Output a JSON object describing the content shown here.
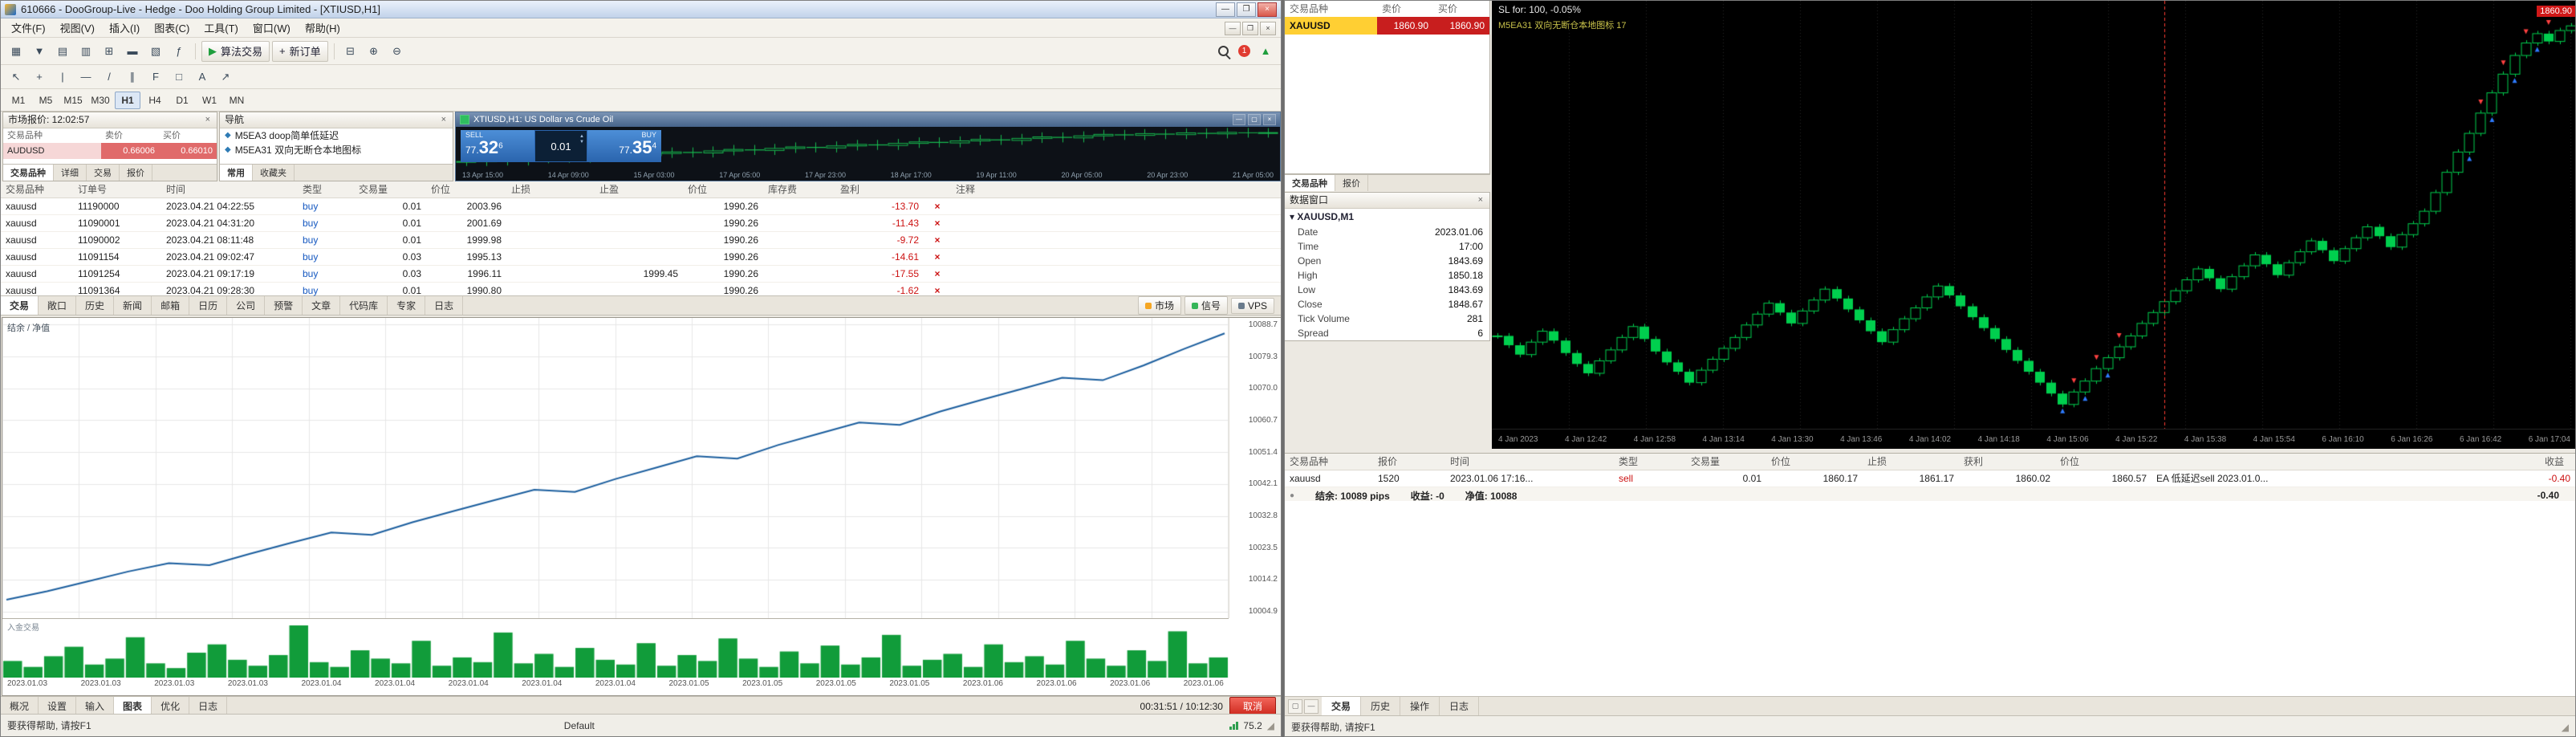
{
  "icons": {
    "close": "×",
    "min": "—",
    "restore": "❐",
    "maximize": "▢",
    "up": "▲",
    "down": "▼",
    "play": "▶",
    "plus": "+",
    "robot": "◆",
    "dot": "●",
    "grip": "◢",
    "dropdown": "▾"
  },
  "left": {
    "title": "610666 - DooGroup-Live - Hedge - Doo Holding Group Limited - [XTIUSD,H1]",
    "menus": [
      "文件(F)",
      "视图(V)",
      "插入(I)",
      "图表(C)",
      "工具(T)",
      "窗口(W)",
      "帮助(H)"
    ],
    "toolbar1": [
      {
        "name": "new-chart-icon",
        "glyph": "▦"
      },
      {
        "name": "profiles-icon",
        "glyph": "▼"
      },
      {
        "name": "market-watch-icon",
        "glyph": "▤"
      },
      {
        "name": "data-window-icon",
        "glyph": "▥"
      },
      {
        "name": "navigator-icon",
        "glyph": "⊞"
      },
      {
        "name": "toolbox-icon",
        "glyph": "▬"
      },
      {
        "name": "strategy-tester-icon",
        "glyph": "▧"
      },
      {
        "name": "indicators-icon",
        "glyph": "ƒ"
      }
    ],
    "algo_button": "算法交易",
    "new_order_button": "新订单",
    "toolbar1_right": [
      {
        "name": "tile-windows-icon",
        "glyph": "⊟"
      },
      {
        "name": "zoom-in-icon",
        "glyph": "⊕"
      },
      {
        "name": "zoom-out-icon",
        "glyph": "⊖"
      }
    ],
    "badge": "1",
    "toolbar2": [
      {
        "name": "cursor-icon",
        "glyph": "↖"
      },
      {
        "name": "crosshair-icon",
        "glyph": "+"
      },
      {
        "name": "vertical-line-icon",
        "glyph": "|"
      },
      {
        "name": "horizontal-line-icon",
        "glyph": "—"
      },
      {
        "name": "trendline-icon",
        "glyph": "/"
      },
      {
        "name": "channel-icon",
        "glyph": "∥"
      },
      {
        "name": "fibonacci-icon",
        "glyph": "F"
      },
      {
        "name": "shapes-icon",
        "glyph": "□"
      },
      {
        "name": "text-icon",
        "glyph": "A"
      },
      {
        "name": "arrows-icon",
        "glyph": "↗"
      }
    ],
    "timeframes": [
      {
        "label": "M1"
      },
      {
        "label": "M5"
      },
      {
        "label": "M15"
      },
      {
        "label": "M30"
      },
      {
        "label": "H1",
        "active": true
      },
      {
        "label": "H4"
      },
      {
        "label": "D1"
      },
      {
        "label": "W1"
      },
      {
        "label": "MN"
      }
    ],
    "market_watch": {
      "title": "市场报价: 12:02:57",
      "columns": [
        "交易品种",
        "卖价",
        "买价"
      ],
      "symbol": "AUDUSD",
      "bid": "0.66006",
      "ask": "0.66010",
      "tabs": [
        {
          "label": "交易品种",
          "active": true
        },
        {
          "label": "详细"
        },
        {
          "label": "交易"
        },
        {
          "label": "报价"
        }
      ]
    },
    "navigator": {
      "title": "导航",
      "items": [
        "M5EA3 doop简单低延迟",
        "M5EA31 双向无断仓本地图标"
      ],
      "tabs": [
        {
          "label": "常用",
          "active": true
        },
        {
          "label": "收藏夹"
        }
      ]
    },
    "popup": {
      "title": "XTIUSD,H1: US Dollar vs Crude Oil",
      "sell_label": "SELL",
      "sell_prefix": "77.",
      "sell_big": "32",
      "sell_sup": "6",
      "volume": "0.01",
      "buy_label": "BUY",
      "buy_prefix": "77.",
      "buy_big": "35",
      "buy_sup": "4"
    },
    "orders": {
      "columns": [
        "交易品种",
        "订单号",
        "时间",
        "类型",
        "交易量",
        "价位",
        "止损",
        "止盈",
        "价位",
        "库存费",
        "盈利",
        "注释"
      ],
      "rows": [
        {
          "symbol": "xauusd",
          "order": "11190000",
          "time": "2023.04.21 04:22:55",
          "type": "buy",
          "volume": "0.01",
          "price": "2003.96",
          "sl": "",
          "tp": "",
          "price2": "1990.26",
          "swap": "",
          "profit": "-13.70"
        },
        {
          "symbol": "xauusd",
          "order": "11090001",
          "time": "2023.04.21 04:31:20",
          "type": "buy",
          "volume": "0.01",
          "price": "2001.69",
          "sl": "",
          "tp": "",
          "price2": "1990.26",
          "swap": "",
          "profit": "-11.43"
        },
        {
          "symbol": "xauusd",
          "order": "11090002",
          "time": "2023.04.21 08:11:48",
          "type": "buy",
          "volume": "0.01",
          "price": "1999.98",
          "sl": "",
          "tp": "",
          "price2": "1990.26",
          "swap": "",
          "profit": "-9.72"
        },
        {
          "symbol": "xauusd",
          "order": "11091154",
          "time": "2023.04.21 09:02:47",
          "type": "buy",
          "volume": "0.03",
          "price": "1995.13",
          "sl": "",
          "tp": "",
          "price2": "1990.26",
          "swap": "",
          "profit": "-14.61"
        },
        {
          "symbol": "xauusd",
          "order": "11091254",
          "time": "2023.04.21 09:17:19",
          "type": "buy",
          "volume": "0.03",
          "price": "1996.11",
          "sl": "",
          "tp": "1999.45",
          "price2": "1990.26",
          "swap": "",
          "profit": "-17.55"
        },
        {
          "symbol": "xauusd",
          "order": "11091364",
          "time": "2023.04.21 09:28:30",
          "type": "buy",
          "volume": "0.01",
          "price": "1990.80",
          "sl": "",
          "tp": "",
          "price2": "1990.26",
          "swap": "",
          "profit": "-1.62"
        }
      ]
    },
    "toolbox_tabs": [
      {
        "label": "交易",
        "active": true
      },
      {
        "label": "敞口"
      },
      {
        "label": "历史"
      },
      {
        "label": "新闻"
      },
      {
        "label": "邮箱"
      },
      {
        "label": "日历"
      },
      {
        "label": "公司"
      },
      {
        "label": "预警"
      },
      {
        "label": "文章"
      },
      {
        "label": "代码库"
      },
      {
        "label": "专家"
      },
      {
        "label": "日志"
      }
    ],
    "toolbox_right": [
      {
        "label": "市场",
        "color": "#f5a623"
      },
      {
        "label": "信号",
        "color": "#35b558"
      },
      {
        "label": "VPS",
        "color": "#6a7b8c"
      }
    ],
    "tester": {
      "legend": "结余 / 净值",
      "vol_label": "入金交易",
      "progress": "00:31:51 / 10:12:30",
      "cancel": "取消",
      "tabs": [
        {
          "label": "概况"
        },
        {
          "label": "设置"
        },
        {
          "label": "输入"
        },
        {
          "label": "图表",
          "active": true
        },
        {
          "label": "优化"
        },
        {
          "label": "日志"
        }
      ]
    },
    "status": {
      "help": "要获得帮助, 请按F1",
      "profile": "Default",
      "meter": "75.2"
    }
  },
  "right": {
    "market_watch": {
      "columns": [
        "交易品种",
        "卖价",
        "买价"
      ],
      "symbol": "XAUUSD",
      "bid": "1860.90",
      "ask": "1860.90",
      "tabs": [
        {
          "label": "交易品种",
          "active": true
        },
        {
          "label": "报价"
        }
      ]
    },
    "data_window": {
      "title": "数据窗口",
      "symbol": "XAUUSD,M1",
      "rows": [
        {
          "label": "Date",
          "value": "2023.01.06"
        },
        {
          "label": "Time",
          "value": "17:00"
        },
        {
          "label": "Open",
          "value": "1843.69"
        },
        {
          "label": "High",
          "value": "1850.18"
        },
        {
          "label": "Low",
          "value": "1843.69"
        },
        {
          "label": "Close",
          "value": "1848.67"
        },
        {
          "label": "Tick Volume",
          "value": "281"
        },
        {
          "label": "Spread",
          "value": "6"
        }
      ]
    },
    "chart": {
      "overlay1": "SL for: 100, -0.05%",
      "overlay2": "M5EA31 双向无断仓本地图标 17",
      "price_tag": "1860.90"
    },
    "trades": {
      "columns": [
        "交易品种",
        "报价",
        "时间",
        "类型",
        "交易量",
        "价位",
        "止损",
        "获利",
        "价位",
        "收益"
      ],
      "row": {
        "symbol": "xauusd",
        "ticket": "1520",
        "time": "2023.01.06 17:16...",
        "type": "sell",
        "volume": "0.01",
        "price": "1860.17",
        "sl": "1861.17",
        "tp": "1860.02",
        "price2": "1860.57",
        "comment": "EA 低延迟sell 2023.01.0...",
        "profit": "-0.40"
      },
      "balance": "结余: 10089 pips",
      "profit_total": "收益: -0",
      "equity": "净值: 10088",
      "profit_far": "-0.40"
    },
    "tabs": [
      {
        "label": "交易",
        "active": true
      },
      {
        "label": "历史"
      },
      {
        "label": "操作"
      },
      {
        "label": "日志"
      }
    ],
    "status": {
      "help": "要获得帮助, 请按F1"
    }
  },
  "chart_data": [
    {
      "id": "popup_chart",
      "type": "candlestick",
      "symbol": "XTIUSD,H1",
      "bg": "#0d1117",
      "color": "#17b84e",
      "closes": [
        76.2,
        76.26,
        76.22,
        76.31,
        76.38,
        76.33,
        76.41,
        76.47,
        76.43,
        76.52,
        76.58,
        76.54,
        76.62,
        76.68,
        76.64,
        76.72,
        76.78,
        76.74,
        76.82,
        76.88,
        76.84,
        76.92,
        76.98,
        76.94,
        77.02,
        77.08,
        77.04,
        77.12,
        77.18,
        77.14,
        77.22,
        77.28,
        77.24,
        77.31,
        77.27,
        77.34,
        77.3,
        77.36,
        77.33,
        77.35
      ],
      "x_labels": [
        "13 Apr 15:00",
        "14 Apr 09:00",
        "15 Apr 03:00",
        "17 Apr 05:00",
        "17 Apr 23:00",
        "18 Apr 17:00",
        "19 Apr 11:00",
        "20 Apr 05:00",
        "20 Apr 23:00",
        "21 Apr 05:00"
      ]
    },
    {
      "id": "tester_equity",
      "type": "line",
      "title": "结余 / 净值",
      "color": "#1b5e9e",
      "values": [
        10000.0,
        10002.8,
        10006.1,
        10009.4,
        10012.2,
        10011.5,
        10015.3,
        10018.9,
        10022.4,
        10021.6,
        10025.8,
        10029.5,
        10033.1,
        10036.6,
        10035.9,
        10040.2,
        10044.0,
        10047.8,
        10047.0,
        10051.5,
        10055.3,
        10059.0,
        10058.2,
        10062.7,
        10066.5,
        10070.2,
        10073.9,
        10073.1,
        10078.0,
        10083.5,
        10088.7
      ],
      "y_labels": [
        "10088.7",
        "10079.3",
        "10070.0",
        "10060.7",
        "10051.4",
        "10042.1",
        "10032.8",
        "10023.5",
        "10014.2",
        "10004.9"
      ],
      "x_labels": [
        "2023.01.03",
        "2023.01.03",
        "2023.01.03",
        "2023.01.03",
        "2023.01.04",
        "2023.01.04",
        "2023.01.04",
        "2023.01.04",
        "2023.01.04",
        "2023.01.05",
        "2023.01.05",
        "2023.01.05",
        "2023.01.05",
        "2023.01.06",
        "2023.01.06",
        "2023.01.06",
        "2023.01.06"
      ]
    },
    {
      "id": "tester_volume",
      "type": "bar",
      "color": "#119c3a",
      "values": [
        14,
        9,
        18,
        26,
        11,
        16,
        34,
        12,
        8,
        21,
        28,
        15,
        10,
        19,
        44,
        13,
        9,
        23,
        16,
        12,
        31,
        10,
        17,
        13,
        38,
        12,
        20,
        9,
        25,
        15,
        11,
        29,
        10,
        19,
        14,
        33,
        16,
        9,
        22,
        12,
        27,
        11,
        17,
        36,
        10,
        15,
        20,
        9,
        28,
        13,
        18,
        11,
        31,
        16,
        10,
        23,
        14,
        39,
        12,
        17
      ]
    },
    {
      "id": "main_chart",
      "type": "candlestick",
      "symbol": "XAUUSD,M1",
      "bg": "#000000",
      "color": "#00cf4e",
      "grid_step": 96,
      "event_line_frac": 0.62,
      "buy_markers": [
        50,
        52,
        54,
        86,
        88,
        90,
        92
      ],
      "sell_markers": [
        51,
        53,
        55,
        87,
        89,
        91,
        93
      ],
      "closes": [
        1841.0,
        1840.4,
        1839.8,
        1840.6,
        1841.3,
        1840.7,
        1839.9,
        1839.2,
        1838.6,
        1839.4,
        1840.1,
        1840.9,
        1841.6,
        1840.8,
        1840.0,
        1839.3,
        1838.7,
        1838.0,
        1838.8,
        1839.5,
        1840.2,
        1840.9,
        1841.7,
        1842.4,
        1843.1,
        1842.5,
        1841.8,
        1842.6,
        1843.3,
        1844.0,
        1843.4,
        1842.7,
        1842.0,
        1841.3,
        1840.6,
        1841.4,
        1842.1,
        1842.8,
        1843.5,
        1844.2,
        1843.6,
        1842.9,
        1842.2,
        1841.5,
        1840.8,
        1840.1,
        1839.4,
        1838.7,
        1838.0,
        1837.3,
        1836.6,
        1837.4,
        1838.1,
        1838.9,
        1839.6,
        1840.3,
        1841.0,
        1841.8,
        1842.5,
        1843.2,
        1843.9,
        1844.6,
        1845.3,
        1844.7,
        1844.0,
        1844.8,
        1845.5,
        1846.2,
        1845.6,
        1844.9,
        1845.7,
        1846.4,
        1847.1,
        1846.5,
        1845.8,
        1846.6,
        1847.3,
        1848.0,
        1847.4,
        1846.7,
        1847.5,
        1848.2,
        1849.0,
        1850.2,
        1851.5,
        1852.8,
        1854.0,
        1855.3,
        1856.6,
        1857.8,
        1859.0,
        1859.8,
        1860.4,
        1859.9,
        1860.6,
        1860.9
      ],
      "x_labels": [
        "4 Jan 2023",
        "4 Jan 12:42",
        "4 Jan 12:58",
        "4 Jan 13:14",
        "4 Jan 13:30",
        "4 Jan 13:46",
        "4 Jan 14:02",
        "4 Jan 14:18",
        "4 Jan 15:06",
        "4 Jan 15:22",
        "4 Jan 15:38",
        "4 Jan 15:54",
        "6 Jan 16:10",
        "6 Jan 16:26",
        "6 Jan 16:42",
        "6 Jan 17:04"
      ]
    }
  ]
}
